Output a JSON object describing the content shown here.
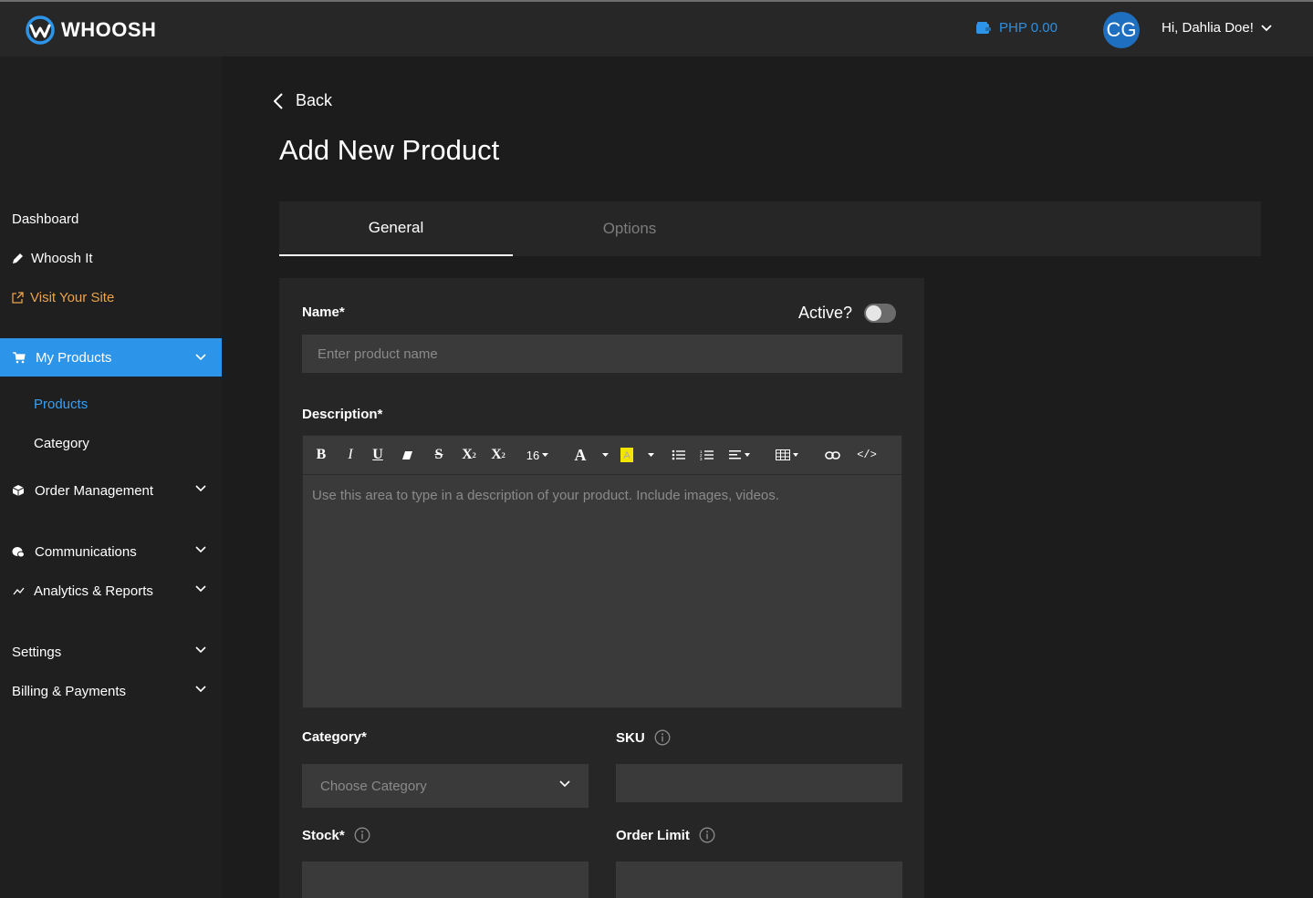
{
  "header": {
    "logo_text": "WHOOSH",
    "wallet_balance": "PHP 0.00",
    "avatar_initials": "CG",
    "greeting": "Hi, Dahlia Doe!"
  },
  "sidebar": {
    "dashboard": "Dashboard",
    "whoosh_it": "Whoosh It",
    "visit_site": "Visit Your Site",
    "my_products": "My Products",
    "products": "Products",
    "category": "Category",
    "order_management": "Order Management",
    "communications": "Communications",
    "analytics": "Analytics & Reports",
    "settings": "Settings",
    "billing": "Billing & Payments"
  },
  "page": {
    "back_label": "Back",
    "title": "Add New Product"
  },
  "tabs": {
    "general": "General",
    "options": "Options"
  },
  "form": {
    "name_label": "Name*",
    "name_placeholder": "Enter product name",
    "active_label": "Active?",
    "active_value": false,
    "description_label": "Description*",
    "description_placeholder": "Use this area to type in a description of your product. Include images, videos.",
    "font_size": "16",
    "category_label": "Category*",
    "category_placeholder": "Choose Category",
    "sku_label": "SKU",
    "stock_label": "Stock*",
    "order_limit_label": "Order Limit"
  },
  "colors": {
    "accent": "#2c95e9",
    "visit_site": "#e9a44c",
    "background": "#1c1c1c",
    "panel": "#262626",
    "input": "#3a3a3a"
  }
}
